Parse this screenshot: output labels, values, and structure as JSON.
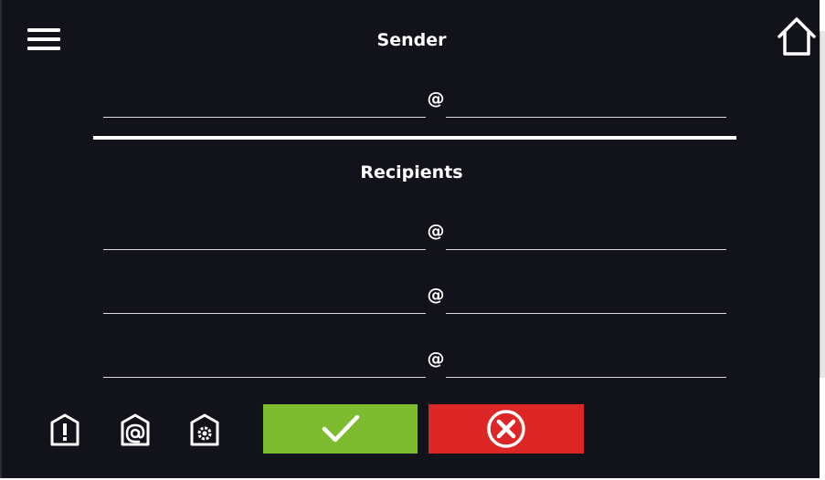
{
  "header": {
    "menu_icon": "hamburger-menu-icon",
    "home_icon": "home-icon",
    "sender_title": "Sender",
    "recipients_title": "Recipients"
  },
  "sender": {
    "at": "@",
    "local": "",
    "domain": ""
  },
  "recipients": [
    {
      "at": "@",
      "local": "",
      "domain": ""
    },
    {
      "at": "@",
      "local": "",
      "domain": ""
    },
    {
      "at": "@",
      "local": "",
      "domain": ""
    }
  ],
  "bottom_bar": {
    "icons": [
      "alarm-icon",
      "email-settings-icon",
      "settings-icon"
    ],
    "confirm_icon": "check-icon",
    "cancel_icon": "cancel-x-icon"
  },
  "colors": {
    "background": "#11121a",
    "confirm": "#7dbb2f",
    "cancel": "#dd2726",
    "foreground": "#ffffff"
  }
}
